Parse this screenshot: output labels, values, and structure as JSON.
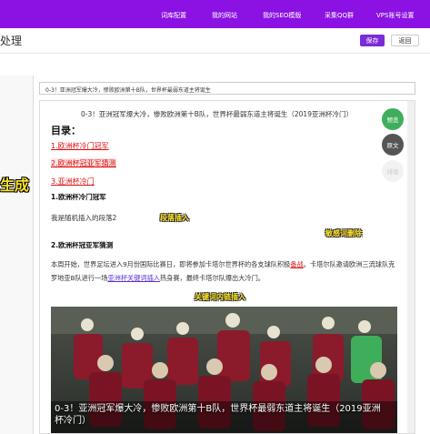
{
  "nav": {
    "items": [
      "词库配置",
      "我的网站",
      "我的SEO模版",
      "采集QQ群",
      "VPS账号设置"
    ]
  },
  "header": {
    "title": "处理",
    "save_label": "保存",
    "back_label": "返回"
  },
  "left_overlay": "生成",
  "article": {
    "title_value": "0-3！亚洲冠军爆大冷，惨败欧洲第十B队，世界杯最弱东道主将诞生",
    "heading": "0-3！亚洲冠军爆大冷，惨败欧洲第十B队，世界杯最弱东道主将诞生（2019亚洲杯冷门）",
    "toc_title": "目录：",
    "toc": [
      "1.欧洲杯冷门冠军",
      "2.欧洲杯冠亚军猜测",
      "3.亚洲杯冷门"
    ],
    "section1": "1.欧洲杯冷门冠军",
    "inserted_paragraph": "我是随机插入的段落2",
    "section2": "2.欧洲杯冠亚军猜测",
    "body_pre": "本周开始，世界足坛进入9月份国际比赛日，即将参加卡塔尔世界杯的各支球队积极",
    "body_keyword": "备战",
    "body_mid": "。卡塔尔队邀请欧洲三流球队克罗地亚B队进行一场",
    "body_link": "亚洲杯关键词插入",
    "body_post": "热身赛，最终卡塔尔队爆出大冷门。",
    "image_caption": "0-3！亚洲冠军爆大冷，惨败欧洲第十B队，世界杯最弱东道主将诞生（2019亚洲杯冷门）"
  },
  "annotations": {
    "paragraph_insert": "段落插入",
    "sensitive_delete": "敏感词删除",
    "keyword_link_insert": "关键词内链插入"
  },
  "side_buttons": {
    "preview": "预览",
    "original": "原文",
    "third": "排版"
  },
  "colors": {
    "brand": "#8b12e3",
    "keyword": "#e01010",
    "preview": "#3fae5a",
    "original": "#555555"
  }
}
